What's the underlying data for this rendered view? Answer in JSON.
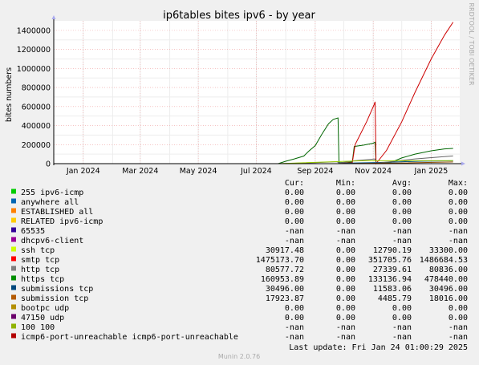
{
  "chart_data": {
    "type": "line",
    "title": "ip6tables bites ipv6 - by year",
    "ylabel": "bites numbers",
    "side_label": "RRDTOOL / TOBI OETIKER",
    "ylim": [
      0,
      1500000
    ],
    "yticks": [
      0,
      200000,
      400000,
      600000,
      800000,
      1000000,
      1200000,
      1400000
    ],
    "x_range": [
      "2023-12-01",
      "2025-01-31"
    ],
    "xticks": [
      {
        "date": "2024-01-01",
        "label": "Jan 2024"
      },
      {
        "date": "2024-03-01",
        "label": "Mar 2024"
      },
      {
        "date": "2024-05-01",
        "label": "May 2024"
      },
      {
        "date": "2024-07-01",
        "label": "Jul 2024"
      },
      {
        "date": "2024-09-01",
        "label": "Sep 2024"
      },
      {
        "date": "2024-11-01",
        "label": "Nov 2024"
      },
      {
        "date": "2025-01-01",
        "label": "Jan 2025"
      }
    ],
    "grid": true,
    "series": [
      {
        "name": "https tcp",
        "color": "#00cc00",
        "stroke": "#006600",
        "points": [
          [
            "2024-07-24",
            0
          ],
          [
            "2024-08-01",
            25000
          ],
          [
            "2024-08-10",
            50000
          ],
          [
            "2024-08-20",
            80000
          ],
          [
            "2024-08-25",
            130000
          ],
          [
            "2024-09-01",
            190000
          ],
          [
            "2024-09-08",
            310000
          ],
          [
            "2024-09-15",
            420000
          ],
          [
            "2024-09-20",
            465000
          ],
          [
            "2024-09-25",
            480000
          ],
          [
            "2024-09-26",
            10000
          ],
          [
            "2024-10-10",
            18000
          ],
          [
            "2024-10-12",
            180000
          ],
          [
            "2024-10-22",
            195000
          ],
          [
            "2024-11-01",
            215000
          ],
          [
            "2024-11-03",
            225000
          ],
          [
            "2024-11-04",
            5000
          ],
          [
            "2024-11-20",
            15000
          ],
          [
            "2024-12-01",
            60000
          ],
          [
            "2024-12-15",
            100000
          ],
          [
            "2025-01-01",
            135000
          ],
          [
            "2025-01-15",
            155000
          ],
          [
            "2025-01-24",
            160000
          ]
        ]
      },
      {
        "name": "smtp tcp",
        "color": "#ff0000",
        "stroke": "#cc0000",
        "points": [
          [
            "2024-09-25",
            0
          ],
          [
            "2024-10-10",
            10000
          ],
          [
            "2024-10-13",
            200000
          ],
          [
            "2024-10-25",
            440000
          ],
          [
            "2024-11-02",
            620000
          ],
          [
            "2024-11-03",
            650000
          ],
          [
            "2024-11-04",
            0
          ],
          [
            "2024-11-15",
            140000
          ],
          [
            "2024-12-01",
            440000
          ],
          [
            "2024-12-15",
            750000
          ],
          [
            "2025-01-01",
            1100000
          ],
          [
            "2025-01-15",
            1350000
          ],
          [
            "2025-01-24",
            1486684
          ]
        ]
      },
      {
        "name": "submissions tcp",
        "color": "#0066b3",
        "stroke": "#004d88",
        "points": [
          [
            "2024-09-26",
            0
          ],
          [
            "2024-10-12",
            8000
          ],
          [
            "2024-11-05",
            12000
          ],
          [
            "2024-12-20",
            25000
          ],
          [
            "2025-01-24",
            30496
          ]
        ]
      },
      {
        "name": "http tcp",
        "color": "#888888",
        "stroke": "#666666",
        "points": [
          [
            "2024-07-24",
            0
          ],
          [
            "2024-09-01",
            10000
          ],
          [
            "2024-09-24",
            20000
          ],
          [
            "2024-09-26",
            5000
          ],
          [
            "2024-10-12",
            30000
          ],
          [
            "2024-11-03",
            50000
          ],
          [
            "2024-11-04",
            3000
          ],
          [
            "2024-12-15",
            50000
          ],
          [
            "2025-01-24",
            80577
          ]
        ]
      },
      {
        "name": "ssh tcp",
        "color": "#ccff00",
        "stroke": "#99cc00",
        "points": [
          [
            "2024-07-24",
            0
          ],
          [
            "2024-09-20",
            20000
          ],
          [
            "2024-10-20",
            30000
          ],
          [
            "2025-01-24",
            30917
          ]
        ]
      },
      {
        "name": "submission tcp",
        "color": "#b35a00",
        "stroke": "#8a4500",
        "points": [
          [
            "2024-09-26",
            0
          ],
          [
            "2024-12-01",
            8000
          ],
          [
            "2025-01-24",
            17923
          ]
        ]
      }
    ]
  },
  "legend": {
    "header": {
      "cur": "Cur:",
      "min": "Min:",
      "avg": "Avg:",
      "max": "Max:"
    },
    "rows": [
      {
        "label": "255 ipv6-icmp",
        "color": "#00cc00",
        "cur": "0.00",
        "min": "0.00",
        "avg": "0.00",
        "max": "0.00"
      },
      {
        "label": "anywhere all",
        "color": "#0066b3",
        "cur": "0.00",
        "min": "0.00",
        "avg": "0.00",
        "max": "0.00"
      },
      {
        "label": "ESTABLISHED all",
        "color": "#ff8000",
        "cur": "0.00",
        "min": "0.00",
        "avg": "0.00",
        "max": "0.00"
      },
      {
        "label": "RELATED ipv6-icmp",
        "color": "#ffcc00",
        "cur": "0.00",
        "min": "0.00",
        "avg": "0.00",
        "max": "0.00"
      },
      {
        "label": "65535",
        "color": "#330099",
        "cur": "-nan",
        "min": "-nan",
        "avg": "-nan",
        "max": "-nan"
      },
      {
        "label": "dhcpv6-client",
        "color": "#990099",
        "cur": "-nan",
        "min": "-nan",
        "avg": "-nan",
        "max": "-nan"
      },
      {
        "label": "ssh tcp",
        "color": "#ccff00",
        "cur": "30917.48",
        "min": "0.00",
        "avg": "12790.19",
        "max": "33300.00"
      },
      {
        "label": "smtp tcp",
        "color": "#ff0000",
        "cur": "1475173.70",
        "min": "0.00",
        "avg": "351705.76",
        "max": "1486684.53"
      },
      {
        "label": "http tcp",
        "color": "#808080",
        "cur": "80577.72",
        "min": "0.00",
        "avg": "27339.61",
        "max": "80836.00"
      },
      {
        "label": "https tcp",
        "color": "#008f00",
        "cur": "160953.89",
        "min": "0.00",
        "avg": "133136.94",
        "max": "478440.00"
      },
      {
        "label": "submissions tcp",
        "color": "#00487d",
        "cur": "30496.00",
        "min": "0.00",
        "avg": "11583.06",
        "max": "30496.00"
      },
      {
        "label": "submission tcp",
        "color": "#b35a00",
        "cur": "17923.87",
        "min": "0.00",
        "avg": "4485.79",
        "max": "18016.00"
      },
      {
        "label": "bootpc udp",
        "color": "#b38f00",
        "cur": "0.00",
        "min": "0.00",
        "avg": "0.00",
        "max": "0.00"
      },
      {
        "label": "47150 udp",
        "color": "#6b006b",
        "cur": "0.00",
        "min": "0.00",
        "avg": "0.00",
        "max": "0.00"
      },
      {
        "label": "100 100",
        "color": "#8fb300",
        "cur": "-nan",
        "min": "-nan",
        "avg": "-nan",
        "max": "-nan"
      },
      {
        "label": "icmp6-port-unreachable icmp6-port-unreachable",
        "color": "#b30000",
        "cur": "-nan",
        "min": "-nan",
        "avg": "-nan",
        "max": "-nan"
      }
    ],
    "last_update": "Last update: Fri Jan 24 01:00:29 2025"
  },
  "footer": "Munin 2.0.76"
}
